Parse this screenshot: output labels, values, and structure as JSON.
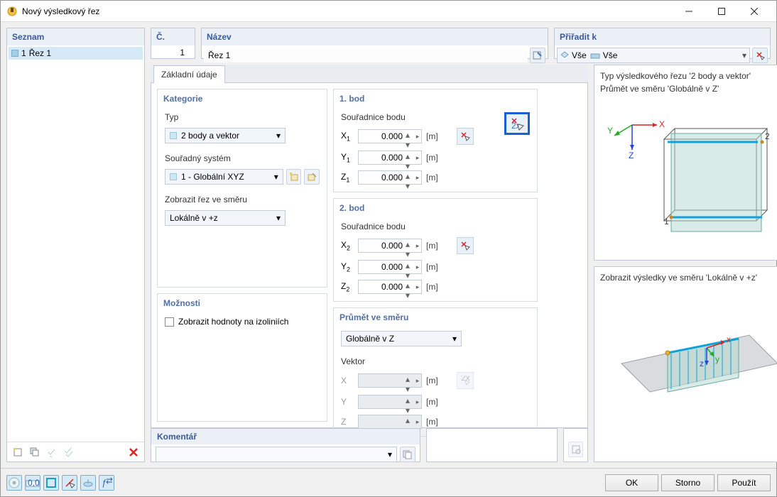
{
  "window": {
    "title": "Nový výsledkový řez"
  },
  "sidebar": {
    "header": "Seznam",
    "items": [
      {
        "index": "1",
        "label": "Řez 1"
      }
    ]
  },
  "top": {
    "number_header": "Č.",
    "number_value": "1",
    "name_header": "Název",
    "name_value": "Řez 1",
    "assign_header": "Přiřadit k",
    "assign_value1": "Vše",
    "assign_value2": "Vše"
  },
  "tabs": {
    "basic": "Základní údaje"
  },
  "category": {
    "legend": "Kategorie",
    "type_label": "Typ",
    "type_value": "2 body a vektor",
    "coord_sys_label": "Souřadný systém",
    "coord_sys_value": "1 - Globální XYZ",
    "show_dir_label": "Zobrazit řez ve směru",
    "show_dir_value": "Lokálně v +z"
  },
  "options": {
    "legend": "Možnosti",
    "isolines": "Zobrazit hodnoty na izoliniích"
  },
  "point1": {
    "legend": "1. bod",
    "coord_label": "Souřadnice bodu",
    "x": "X",
    "y": "Y",
    "z": "Z",
    "idx": "1",
    "unit": "[m]",
    "val": "0.000"
  },
  "point2": {
    "legend": "2. bod",
    "coord_label": "Souřadnice bodu",
    "x": "X",
    "y": "Y",
    "z": "Z",
    "idx": "2",
    "unit": "[m]",
    "val": "0.000"
  },
  "projection": {
    "legend": "Průmět ve směru",
    "value": "Globálně v Z",
    "vector_label": "Vektor",
    "x": "X",
    "y": "Y",
    "z": "Z",
    "unit": "[m]"
  },
  "comment": {
    "legend": "Komentář"
  },
  "preview": {
    "line1": "Typ výsledkového řezu '2 body a vektor'",
    "line2": "Průmět ve směru 'Globálně v Z'",
    "line3": "Zobrazit výsledky ve směru 'Lokálně v +z'"
  },
  "buttons": {
    "ok": "OK",
    "cancel": "Storno",
    "apply": "Použít"
  }
}
